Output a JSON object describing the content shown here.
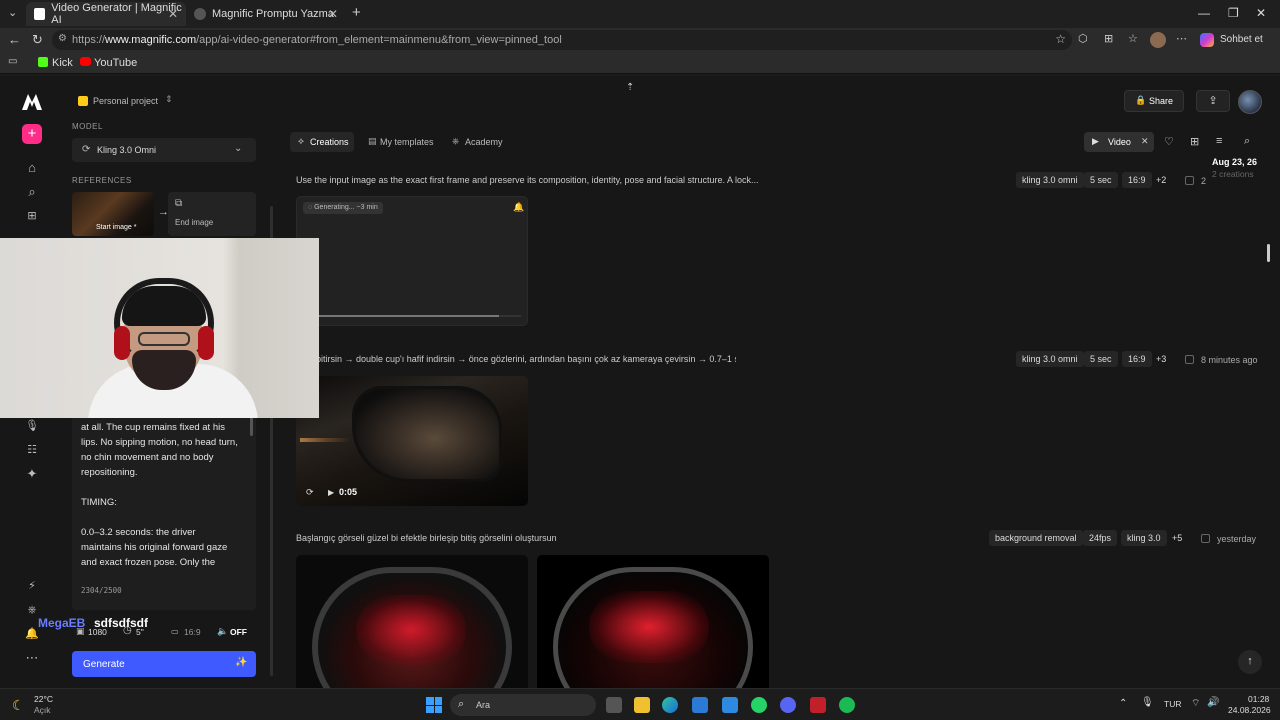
{
  "browser": {
    "tabs": [
      {
        "title": "Video Generator | Magnific AI",
        "active": true
      },
      {
        "title": "Magnific Promptu Yazma",
        "active": false
      }
    ],
    "url_prefix": "https://",
    "url_domain": "www.magnific.com",
    "url_path": "/app/ai-video-generator#from_element=mainmenu&from_view=pinned_tool",
    "profile_label": "Sohbet et",
    "bookmarks": [
      {
        "label": "Kick"
      },
      {
        "label": "YouTube"
      }
    ]
  },
  "app": {
    "project": "Personal project",
    "share_label": "Share",
    "model_section_label": "MODEL",
    "model_name": "Kling 3.0 Omni",
    "references_label": "REFERENCES",
    "start_image_label": "Start image *",
    "end_image_label": "End image",
    "prompt_lines": [
      "at all. The cup remains fixed at his",
      "lips. No sipping motion, no head turn,",
      "no chin movement and no body",
      "repositioning.",
      "",
      "TIMING:",
      "",
      "0.0–3.2 seconds: the driver",
      "maintains his original forward gaze",
      "and exact frozen pose. Only the"
    ],
    "char_count": "2304/2500",
    "settings": {
      "resolution": "1080",
      "duration": "5\"",
      "ratio": "16:9",
      "audio": "OFF"
    },
    "generate_label": "Generate",
    "overlay_text_1": "MegaEB",
    "overlay_text_2": "sdfsdfsdf"
  },
  "tabs": [
    {
      "label": "Creations",
      "active": true
    },
    {
      "label": "My templates",
      "active": false
    },
    {
      "label": "Academy",
      "active": false
    }
  ],
  "filter": {
    "video_label": "Video",
    "date_label": "Aug 23, 26",
    "date_sub": "2 creations"
  },
  "creations": [
    {
      "prompt": "Use the input image as the exact first frame and preserve its composition, identity, pose and facial structure. A lock...",
      "chips": [
        "kling 3.0 omni",
        "5 sec",
        "16:9",
        "+2"
      ],
      "meta": "2",
      "status": "Generating... ~3 min"
    },
    {
      "prompt": "...nu bitirsin → double cup'ı hafif indirsin → önce gözlerini, ardından başını çok az kameraya çevirsin → 0.7–1 sani...",
      "chips": [
        "kling 3.0 omni",
        "5 sec",
        "16:9",
        "+3"
      ],
      "meta": "8 minutes ago",
      "duration": "0:05"
    },
    {
      "prompt": "Başlangıç görseli güzel bi efektle birleşip bitiş görselini oluştursun",
      "chips": [
        "background removal",
        "24fps",
        "kling 3.0",
        "+5"
      ],
      "meta": "yesterday"
    }
  ],
  "taskbar": {
    "weather_temp": "22°C",
    "weather_desc": "Açık",
    "search_label": "Ara",
    "lang": "TUR",
    "time": "01:28",
    "date": "24.08.2026"
  }
}
